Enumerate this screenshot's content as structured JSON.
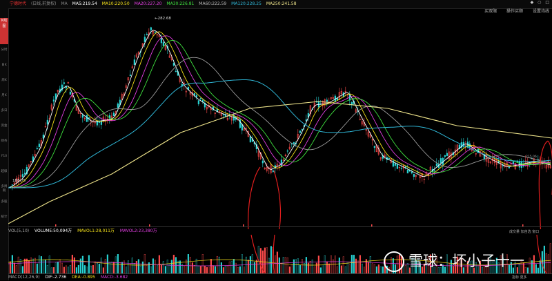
{
  "colors": {
    "ma5": "#ffffff",
    "ma10": "#f5e21a",
    "ma20": "#e23ee2",
    "ma30": "#3fe13f",
    "ma60": "#9a9a9a",
    "ma120": "#2fb6d6",
    "ma250": "#f0e68c",
    "up": "#ff4b4b",
    "down": "#28d3d3",
    "annotation": "#e21e1e"
  },
  "topbar": {
    "title": "宁德时代",
    "adjust": "(日线,前复权)",
    "ma_label": "MA",
    "ma5": "MA5:219.54",
    "ma10": "MA10:220.50",
    "ma20": "MA20:227.20",
    "ma30": "MA30:226.81",
    "ma60": "MA60:222.59",
    "ma120": "MA120:228.25",
    "ma250": "MA250:241.58",
    "right": [
      "◆",
      "○",
      "□"
    ]
  },
  "subbar": [
    "买双限",
    "操作买顺",
    "设置均线"
  ],
  "leftbar": {
    "active": "K线图",
    "items": [
      "分时",
      "日K",
      "周K",
      "月K",
      "多日",
      "资金",
      "财务",
      "F10",
      "超级",
      "多周期",
      "多股",
      "统计"
    ]
  },
  "price_labels": {
    "high": "282.68",
    "low": "188.75",
    "current_small": "215.06"
  },
  "volume": {
    "label": "VOL(5,10)",
    "volume": "VOLUME:50,094万",
    "mavol1": "MAVOL1:28,011万",
    "mavol2": "MAVOL2:23,380万"
  },
  "vol_buttons": [
    "成交量",
    "加自选",
    "窗口"
  ],
  "macd": {
    "label": "MACD(12,26,9)",
    "dif": "DIF:-2.736",
    "dea": "DEA:-0.895",
    "macd": "MACD:-3.682"
  },
  "macd_buttons": [
    "指标",
    "更多"
  ],
  "watermark": {
    "brand": "雪球",
    "author": "：坏小子十一"
  }
}
